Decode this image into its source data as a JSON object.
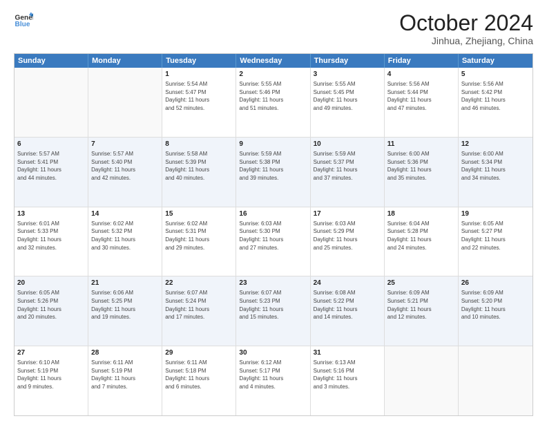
{
  "logo": {
    "line1": "General",
    "line2": "Blue"
  },
  "title": "October 2024",
  "location": "Jinhua, Zhejiang, China",
  "header_days": [
    "Sunday",
    "Monday",
    "Tuesday",
    "Wednesday",
    "Thursday",
    "Friday",
    "Saturday"
  ],
  "weeks": [
    [
      {
        "day": "",
        "info": ""
      },
      {
        "day": "",
        "info": ""
      },
      {
        "day": "1",
        "info": "Sunrise: 5:54 AM\nSunset: 5:47 PM\nDaylight: 11 hours\nand 52 minutes."
      },
      {
        "day": "2",
        "info": "Sunrise: 5:55 AM\nSunset: 5:46 PM\nDaylight: 11 hours\nand 51 minutes."
      },
      {
        "day": "3",
        "info": "Sunrise: 5:55 AM\nSunset: 5:45 PM\nDaylight: 11 hours\nand 49 minutes."
      },
      {
        "day": "4",
        "info": "Sunrise: 5:56 AM\nSunset: 5:44 PM\nDaylight: 11 hours\nand 47 minutes."
      },
      {
        "day": "5",
        "info": "Sunrise: 5:56 AM\nSunset: 5:42 PM\nDaylight: 11 hours\nand 46 minutes."
      }
    ],
    [
      {
        "day": "6",
        "info": "Sunrise: 5:57 AM\nSunset: 5:41 PM\nDaylight: 11 hours\nand 44 minutes."
      },
      {
        "day": "7",
        "info": "Sunrise: 5:57 AM\nSunset: 5:40 PM\nDaylight: 11 hours\nand 42 minutes."
      },
      {
        "day": "8",
        "info": "Sunrise: 5:58 AM\nSunset: 5:39 PM\nDaylight: 11 hours\nand 40 minutes."
      },
      {
        "day": "9",
        "info": "Sunrise: 5:59 AM\nSunset: 5:38 PM\nDaylight: 11 hours\nand 39 minutes."
      },
      {
        "day": "10",
        "info": "Sunrise: 5:59 AM\nSunset: 5:37 PM\nDaylight: 11 hours\nand 37 minutes."
      },
      {
        "day": "11",
        "info": "Sunrise: 6:00 AM\nSunset: 5:36 PM\nDaylight: 11 hours\nand 35 minutes."
      },
      {
        "day": "12",
        "info": "Sunrise: 6:00 AM\nSunset: 5:34 PM\nDaylight: 11 hours\nand 34 minutes."
      }
    ],
    [
      {
        "day": "13",
        "info": "Sunrise: 6:01 AM\nSunset: 5:33 PM\nDaylight: 11 hours\nand 32 minutes."
      },
      {
        "day": "14",
        "info": "Sunrise: 6:02 AM\nSunset: 5:32 PM\nDaylight: 11 hours\nand 30 minutes."
      },
      {
        "day": "15",
        "info": "Sunrise: 6:02 AM\nSunset: 5:31 PM\nDaylight: 11 hours\nand 29 minutes."
      },
      {
        "day": "16",
        "info": "Sunrise: 6:03 AM\nSunset: 5:30 PM\nDaylight: 11 hours\nand 27 minutes."
      },
      {
        "day": "17",
        "info": "Sunrise: 6:03 AM\nSunset: 5:29 PM\nDaylight: 11 hours\nand 25 minutes."
      },
      {
        "day": "18",
        "info": "Sunrise: 6:04 AM\nSunset: 5:28 PM\nDaylight: 11 hours\nand 24 minutes."
      },
      {
        "day": "19",
        "info": "Sunrise: 6:05 AM\nSunset: 5:27 PM\nDaylight: 11 hours\nand 22 minutes."
      }
    ],
    [
      {
        "day": "20",
        "info": "Sunrise: 6:05 AM\nSunset: 5:26 PM\nDaylight: 11 hours\nand 20 minutes."
      },
      {
        "day": "21",
        "info": "Sunrise: 6:06 AM\nSunset: 5:25 PM\nDaylight: 11 hours\nand 19 minutes."
      },
      {
        "day": "22",
        "info": "Sunrise: 6:07 AM\nSunset: 5:24 PM\nDaylight: 11 hours\nand 17 minutes."
      },
      {
        "day": "23",
        "info": "Sunrise: 6:07 AM\nSunset: 5:23 PM\nDaylight: 11 hours\nand 15 minutes."
      },
      {
        "day": "24",
        "info": "Sunrise: 6:08 AM\nSunset: 5:22 PM\nDaylight: 11 hours\nand 14 minutes."
      },
      {
        "day": "25",
        "info": "Sunrise: 6:09 AM\nSunset: 5:21 PM\nDaylight: 11 hours\nand 12 minutes."
      },
      {
        "day": "26",
        "info": "Sunrise: 6:09 AM\nSunset: 5:20 PM\nDaylight: 11 hours\nand 10 minutes."
      }
    ],
    [
      {
        "day": "27",
        "info": "Sunrise: 6:10 AM\nSunset: 5:19 PM\nDaylight: 11 hours\nand 9 minutes."
      },
      {
        "day": "28",
        "info": "Sunrise: 6:11 AM\nSunset: 5:19 PM\nDaylight: 11 hours\nand 7 minutes."
      },
      {
        "day": "29",
        "info": "Sunrise: 6:11 AM\nSunset: 5:18 PM\nDaylight: 11 hours\nand 6 minutes."
      },
      {
        "day": "30",
        "info": "Sunrise: 6:12 AM\nSunset: 5:17 PM\nDaylight: 11 hours\nand 4 minutes."
      },
      {
        "day": "31",
        "info": "Sunrise: 6:13 AM\nSunset: 5:16 PM\nDaylight: 11 hours\nand 3 minutes."
      },
      {
        "day": "",
        "info": ""
      },
      {
        "day": "",
        "info": ""
      }
    ]
  ]
}
